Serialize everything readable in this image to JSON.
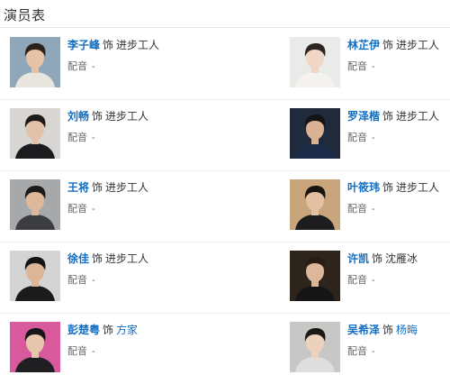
{
  "section": {
    "title": "演员表"
  },
  "cast": [
    {
      "actor": "李子峰",
      "as": "饰",
      "role": "进步工人",
      "role_link": false,
      "dub_label": "配音",
      "dub_value": "-",
      "photo": {
        "bg": "#8fa7b8",
        "shirt": "#e9e6df",
        "hair": "#2a221c",
        "skin": "#e6c3a7"
      }
    },
    {
      "actor": "林芷伊",
      "as": "饰",
      "role": "进步工人",
      "role_link": false,
      "dub_label": "配音",
      "dub_value": "-",
      "photo": {
        "bg": "#e9ebe8",
        "shirt": "#f4f2ee",
        "hair": "#2c2522",
        "skin": "#f0d6c4"
      }
    },
    {
      "actor": "刘畅",
      "as": "饰",
      "role": "进步工人",
      "role_link": false,
      "dub_label": "配音",
      "dub_value": "-",
      "photo": {
        "bg": "#d8d6d2",
        "shirt": "#1c1c1e",
        "hair": "#1e1a18",
        "skin": "#e2c2a8"
      }
    },
    {
      "actor": "罗泽楷",
      "as": "饰",
      "role": "进步工人",
      "role_link": false,
      "dub_label": "配音",
      "dub_value": "-",
      "photo": {
        "bg": "#1f2b3c",
        "shirt": "#1b2a46",
        "hair": "#141414",
        "skin": "#d9b394"
      }
    },
    {
      "actor": "王将",
      "as": "饰",
      "role": "进步工人",
      "role_link": false,
      "dub_label": "配音",
      "dub_value": "-",
      "photo": {
        "bg": "#a6a8aa",
        "shirt": "#3c3d40",
        "hair": "#1c1a19",
        "skin": "#ddb89b"
      }
    },
    {
      "actor": "叶筱玮",
      "as": "饰",
      "role": "进步工人",
      "role_link": false,
      "dub_label": "配音",
      "dub_value": "-",
      "photo": {
        "bg": "#c9a57c",
        "shirt": "#1d1d1f",
        "hair": "#18140f",
        "skin": "#e3c09f"
      }
    },
    {
      "actor": "徐佳",
      "as": "饰",
      "role": "进步工人",
      "role_link": false,
      "dub_label": "配音",
      "dub_value": "-",
      "photo": {
        "bg": "#d4d4d4",
        "shirt": "#1b1b1c",
        "hair": "#141414",
        "skin": "#dcb596"
      }
    },
    {
      "actor": "许凯",
      "as": "饰",
      "role": "沈雁冰",
      "role_link": false,
      "dub_label": "配音",
      "dub_value": "-",
      "photo": {
        "bg": "#2d241c",
        "shirt": "#151515",
        "hair": "#2a1c12",
        "skin": "#dcb79a"
      }
    },
    {
      "actor": "彭楚粤",
      "as": "饰",
      "role": "方家",
      "role_link": true,
      "dub_label": "配音",
      "dub_value": "-",
      "photo": {
        "bg": "#d85a9c",
        "shirt": "#1f1f21",
        "hair": "#161616",
        "skin": "#e6c7ad"
      }
    },
    {
      "actor": "吴希泽",
      "as": "饰",
      "role": "杨晦",
      "role_link": true,
      "dub_label": "配音",
      "dub_value": "-",
      "photo": {
        "bg": "#c7c8c6",
        "shirt": "#dedede",
        "hair": "#1b1816",
        "skin": "#ecd1bc"
      }
    }
  ]
}
